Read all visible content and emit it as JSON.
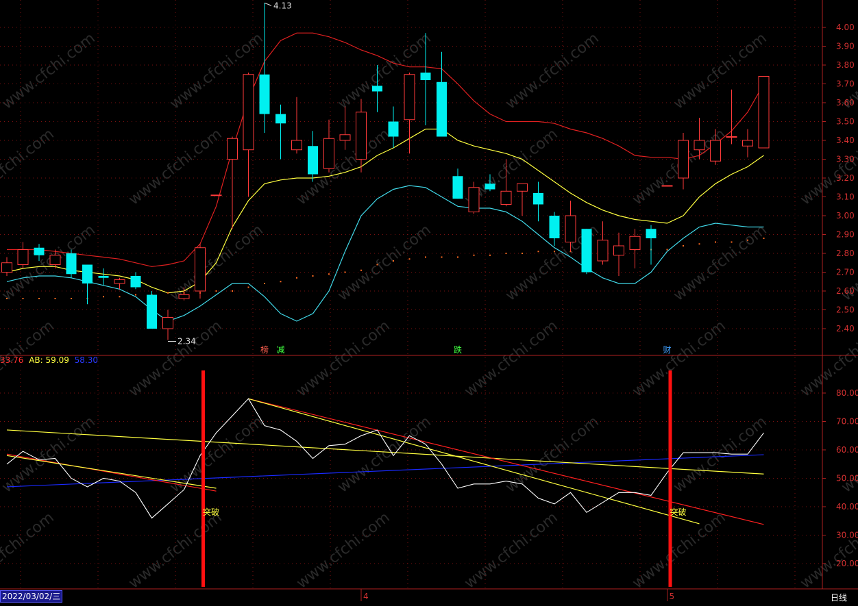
{
  "colors": {
    "up": "#ff3a3a",
    "down": "#00f0f0",
    "upper_band": "#e02020",
    "mid_band": "#ffff40",
    "lower_band": "#40d8e8",
    "sar": "#ff6a20",
    "osc": "#ffffff",
    "ab": "#ffff40",
    "blue": "#1a2aff",
    "grid": "#7a1010"
  },
  "chart_data": [
    {
      "type": "candlestick",
      "ylim": [
        2.3,
        4.15
      ],
      "yticks": [
        "2.40",
        "2.50",
        "2.60",
        "2.70",
        "2.80",
        "2.90",
        "3.00",
        "3.10",
        "3.20",
        "3.30",
        "3.40",
        "3.50",
        "3.60",
        "3.70",
        "3.80",
        "3.90",
        "4.00"
      ],
      "high_annotation": "4.13",
      "low_annotation": "2.34",
      "candles": [
        {
          "o": 2.7,
          "h": 2.78,
          "l": 2.68,
          "c": 2.75
        },
        {
          "o": 2.74,
          "h": 2.86,
          "l": 2.72,
          "c": 2.82
        },
        {
          "o": 2.83,
          "h": 2.85,
          "l": 2.76,
          "c": 2.79
        },
        {
          "o": 2.74,
          "h": 2.82,
          "l": 2.72,
          "c": 2.79
        },
        {
          "o": 2.8,
          "h": 2.82,
          "l": 2.67,
          "c": 2.69
        },
        {
          "o": 2.74,
          "h": 2.74,
          "l": 2.53,
          "c": 2.64
        },
        {
          "o": 2.68,
          "h": 2.72,
          "l": 2.63,
          "c": 2.67
        },
        {
          "o": 2.64,
          "h": 2.67,
          "l": 2.61,
          "c": 2.66
        },
        {
          "o": 2.68,
          "h": 2.7,
          "l": 2.61,
          "c": 2.62
        },
        {
          "o": 2.58,
          "h": 2.6,
          "l": 2.4,
          "c": 2.4
        },
        {
          "o": 2.4,
          "h": 2.5,
          "l": 2.34,
          "c": 2.46
        },
        {
          "o": 2.56,
          "h": 2.62,
          "l": 2.55,
          "c": 2.58
        },
        {
          "o": 2.6,
          "h": 2.85,
          "l": 2.56,
          "c": 2.83
        },
        {
          "o": 3.11,
          "h": 3.11,
          "l": 3.11,
          "c": 3.11
        },
        {
          "o": 3.3,
          "h": 3.42,
          "l": 2.93,
          "c": 3.41
        },
        {
          "o": 3.35,
          "h": 3.76,
          "l": 3.1,
          "c": 3.75
        },
        {
          "o": 3.75,
          "h": 4.13,
          "l": 3.44,
          "c": 3.54
        },
        {
          "o": 3.54,
          "h": 3.59,
          "l": 3.3,
          "c": 3.49
        },
        {
          "o": 3.35,
          "h": 3.63,
          "l": 3.33,
          "c": 3.4
        },
        {
          "o": 3.37,
          "h": 3.45,
          "l": 3.18,
          "c": 3.22
        },
        {
          "o": 3.25,
          "h": 3.51,
          "l": 3.23,
          "c": 3.41
        },
        {
          "o": 3.4,
          "h": 3.58,
          "l": 3.35,
          "c": 3.43
        },
        {
          "o": 3.3,
          "h": 3.62,
          "l": 3.23,
          "c": 3.55
        },
        {
          "o": 3.69,
          "h": 3.8,
          "l": 3.55,
          "c": 3.66
        },
        {
          "o": 3.5,
          "h": 3.58,
          "l": 3.36,
          "c": 3.42
        },
        {
          "o": 3.51,
          "h": 3.76,
          "l": 3.33,
          "c": 3.75
        },
        {
          "o": 3.76,
          "h": 3.97,
          "l": 3.48,
          "c": 3.72
        },
        {
          "o": 3.71,
          "h": 3.87,
          "l": 3.42,
          "c": 3.42
        },
        {
          "o": 3.21,
          "h": 3.25,
          "l": 3.09,
          "c": 3.09
        },
        {
          "o": 3.02,
          "h": 3.18,
          "l": 3.01,
          "c": 3.15
        },
        {
          "o": 3.17,
          "h": 3.22,
          "l": 3.13,
          "c": 3.14
        },
        {
          "o": 3.06,
          "h": 3.3,
          "l": 3.05,
          "c": 3.13
        },
        {
          "o": 3.13,
          "h": 3.17,
          "l": 3.0,
          "c": 3.17
        },
        {
          "o": 3.12,
          "h": 3.18,
          "l": 2.97,
          "c": 3.06
        },
        {
          "o": 3.0,
          "h": 3.02,
          "l": 2.84,
          "c": 2.88
        },
        {
          "o": 2.86,
          "h": 3.08,
          "l": 2.81,
          "c": 3.0
        },
        {
          "o": 2.93,
          "h": 2.93,
          "l": 2.69,
          "c": 2.7
        },
        {
          "o": 2.76,
          "h": 2.97,
          "l": 2.74,
          "c": 2.87
        },
        {
          "o": 2.79,
          "h": 2.91,
          "l": 2.68,
          "c": 2.84
        },
        {
          "o": 2.82,
          "h": 2.93,
          "l": 2.72,
          "c": 2.89
        },
        {
          "o": 2.93,
          "h": 2.95,
          "l": 2.74,
          "c": 2.88
        },
        {
          "o": 3.16,
          "h": 3.16,
          "l": 3.16,
          "c": 3.16
        },
        {
          "o": 3.2,
          "h": 3.44,
          "l": 3.14,
          "c": 3.4
        },
        {
          "o": 3.35,
          "h": 3.52,
          "l": 3.3,
          "c": 3.4
        },
        {
          "o": 3.29,
          "h": 3.46,
          "l": 3.27,
          "c": 3.4
        },
        {
          "o": 3.42,
          "h": 3.67,
          "l": 3.38,
          "c": 3.42
        },
        {
          "o": 3.37,
          "h": 3.46,
          "l": 3.31,
          "c": 3.4
        },
        {
          "o": 3.36,
          "h": 3.74,
          "l": 3.36,
          "c": 3.74
        }
      ],
      "upper_band": [
        2.82,
        2.82,
        2.82,
        2.81,
        2.8,
        2.79,
        2.78,
        2.77,
        2.75,
        2.73,
        2.74,
        2.76,
        2.85,
        3.05,
        3.35,
        3.62,
        3.82,
        3.93,
        3.97,
        3.97,
        3.95,
        3.92,
        3.88,
        3.85,
        3.81,
        3.79,
        3.79,
        3.78,
        3.7,
        3.61,
        3.54,
        3.5,
        3.5,
        3.5,
        3.49,
        3.46,
        3.44,
        3.41,
        3.37,
        3.32,
        3.31,
        3.31,
        3.3,
        3.32,
        3.38,
        3.45,
        3.55,
        3.7
      ],
      "mid_band": [
        2.7,
        2.72,
        2.73,
        2.73,
        2.71,
        2.7,
        2.69,
        2.68,
        2.66,
        2.62,
        2.59,
        2.6,
        2.65,
        2.75,
        2.94,
        3.08,
        3.17,
        3.19,
        3.2,
        3.2,
        3.21,
        3.23,
        3.26,
        3.32,
        3.36,
        3.41,
        3.46,
        3.46,
        3.4,
        3.37,
        3.35,
        3.33,
        3.3,
        3.24,
        3.18,
        3.12,
        3.07,
        3.03,
        3.0,
        2.98,
        2.97,
        2.96,
        3.0,
        3.1,
        3.17,
        3.22,
        3.26,
        3.32
      ],
      "lower_band": [
        2.65,
        2.67,
        2.68,
        2.68,
        2.67,
        2.65,
        2.63,
        2.61,
        2.57,
        2.5,
        2.44,
        2.47,
        2.52,
        2.58,
        2.64,
        2.64,
        2.57,
        2.48,
        2.44,
        2.48,
        2.6,
        2.81,
        3.0,
        3.09,
        3.14,
        3.16,
        3.15,
        3.1,
        3.05,
        3.04,
        3.04,
        3.02,
        2.97,
        2.9,
        2.83,
        2.78,
        2.72,
        2.67,
        2.64,
        2.64,
        2.7,
        2.81,
        2.88,
        2.94,
        2.96,
        2.95,
        2.94,
        2.94
      ],
      "sar": [
        2.56,
        2.56,
        2.56,
        2.56,
        2.56,
        2.56,
        2.57,
        2.57,
        2.58,
        2.58,
        2.59,
        2.59,
        2.59,
        2.6,
        2.6,
        2.62,
        2.64,
        2.65,
        2.67,
        2.68,
        2.69,
        2.7,
        2.71,
        2.74,
        2.76,
        2.77,
        2.78,
        2.78,
        2.78,
        2.79,
        2.79,
        2.8,
        2.8,
        2.81,
        2.81,
        2.81,
        2.82,
        2.82,
        2.82,
        2.82,
        2.82,
        2.82,
        2.84,
        2.85,
        2.86,
        2.86,
        2.87,
        2.88
      ],
      "event_labels": [
        {
          "i": 16,
          "text": "榜",
          "color": "#ff6050"
        },
        {
          "i": 17,
          "text": "减",
          "color": "#40ff40"
        },
        {
          "i": 28,
          "text": "跌",
          "color": "#40ff40"
        },
        {
          "i": 41,
          "text": "财",
          "color": "#40a0ff"
        }
      ]
    },
    {
      "type": "line",
      "ylim": [
        13,
        90
      ],
      "yticks": [
        "20.00",
        "30.00",
        "40.00",
        "50.00",
        "60.00",
        "70.00",
        "80.00"
      ],
      "legend": [
        {
          "text": "33.76",
          "color": "#ff3030"
        },
        {
          "text": "AB: 59.09",
          "color": "#ffff40"
        },
        {
          "text": "58.30",
          "color": "#1a2aff"
        }
      ],
      "osc": [
        55.0,
        59.5,
        56.5,
        57.0,
        50.0,
        47.0,
        50.0,
        49.0,
        45.0,
        36.0,
        41.0,
        46.0,
        58.0,
        66.0,
        72.0,
        78.0,
        68.5,
        67.0,
        63.0,
        57.0,
        61.5,
        62.0,
        65.0,
        67.0,
        58.0,
        65.0,
        62.0,
        55.0,
        46.5,
        48.0,
        48.0,
        49.0,
        48.0,
        43.0,
        41.0,
        45.0,
        38.0,
        41.5,
        45.0,
        45.0,
        44.0,
        52.0,
        59.0,
        59.0,
        59.0,
        58.5,
        58.5,
        66.0
      ],
      "blue_line": {
        "x0": 0,
        "y0": 47.0,
        "x1": 47,
        "y1": 58.3
      },
      "long_yellow": {
        "x0": 0,
        "y0": 67.0,
        "x1": 47,
        "y1": 51.5
      },
      "short_red": {
        "x0": 0,
        "y0": 58.5,
        "x1": 13,
        "y1": 45.5
      },
      "short_yellow": {
        "x0": 0,
        "y0": 58.0,
        "x1": 13,
        "y1": 46.5
      },
      "down_red": {
        "x0": 15,
        "y0": 78.0,
        "x1": 47,
        "y1": 33.76
      },
      "down_yellow": {
        "x0": 15,
        "y0": 78.0,
        "x1": 43,
        "y1": 34.0
      },
      "signals": [
        {
          "i": 12,
          "text": "突破"
        },
        {
          "i": 41,
          "text": "突破"
        }
      ]
    }
  ],
  "x_axis_labels": [
    {
      "i": 22,
      "text": "4"
    },
    {
      "i": 41,
      "text": "5"
    }
  ],
  "date_box": "2022/03/02/三",
  "period_label": "日线",
  "watermark": "www.cfchi.com"
}
